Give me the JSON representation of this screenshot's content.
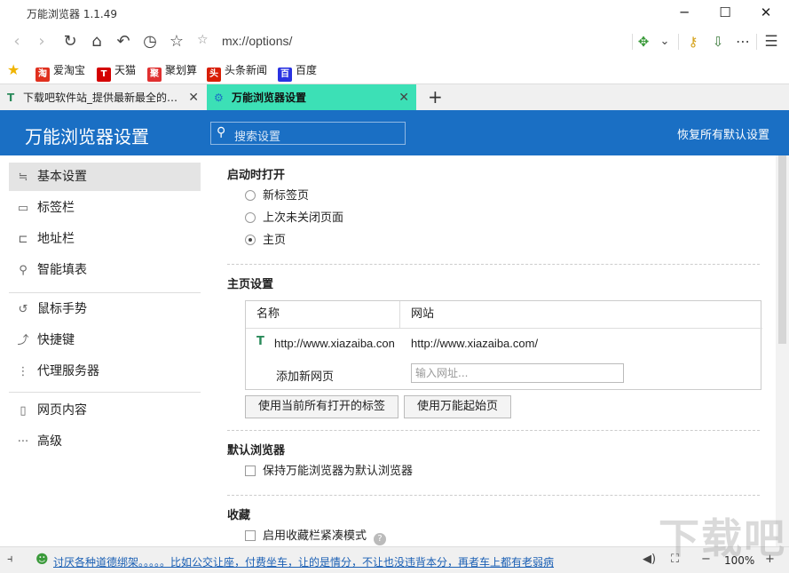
{
  "window": {
    "title": "万能浏览器 1.1.49"
  },
  "nav": {
    "url": "mx://options/"
  },
  "bookmarks": [
    {
      "label": "爱淘宝",
      "icon": "淘",
      "color": "#e0301e"
    },
    {
      "label": "天猫",
      "icon": "T",
      "color": "#d40000"
    },
    {
      "label": "聚划算",
      "icon": "聚",
      "color": "#e03030"
    },
    {
      "label": "头条新闻",
      "icon": "头",
      "color": "#d81e06"
    },
    {
      "label": "百度",
      "icon": "百",
      "color": "#2932e1"
    }
  ],
  "tabs": [
    {
      "label": "下载吧软件站_提供最新最全的…"
    },
    {
      "label": "万能浏览器设置"
    }
  ],
  "header": {
    "title": "万能浏览器设置",
    "search_placeholder": "搜索设置",
    "restore": "恢复所有默认设置"
  },
  "sidebar": [
    {
      "label": "基本设置",
      "icon": "≒"
    },
    {
      "label": "标签栏",
      "icon": "▭"
    },
    {
      "label": "地址栏",
      "icon": "⊏"
    },
    {
      "label": "智能填表",
      "icon": "⚲"
    },
    {
      "label": "鼠标手势",
      "icon": "↺"
    },
    {
      "label": "快捷键",
      "icon": "⤴"
    },
    {
      "label": "代理服务器",
      "icon": "⋮"
    },
    {
      "label": "网页内容",
      "icon": "▯"
    },
    {
      "label": "高级",
      "icon": "···"
    }
  ],
  "startup": {
    "heading": "启动时打开",
    "options": [
      "新标签页",
      "上次未关闭页面",
      "主页"
    ],
    "selected": "主页"
  },
  "homepage": {
    "heading": "主页设置",
    "col_name": "名称",
    "col_site": "网站",
    "row_name": "http://www.xiazaiba.con",
    "row_site": "http://www.xiazaiba.com/",
    "add_label": "添加新网页",
    "add_placeholder": "输入网址...",
    "btn_current": "使用当前所有打开的标签",
    "btn_start": "使用万能起始页"
  },
  "default_browser": {
    "heading": "默认浏览器",
    "check": "保持万能浏览器为默认浏览器"
  },
  "favorites": {
    "heading": "收藏",
    "check": "启用收藏栏紧凑模式"
  },
  "status": {
    "news": "讨厌各种道德绑架。。。。。比如公交让座，付费坐车，让的是情分，不让也没违背本分，再者车上都有老弱病",
    "zoom": "100%"
  },
  "watermark": "下载吧"
}
